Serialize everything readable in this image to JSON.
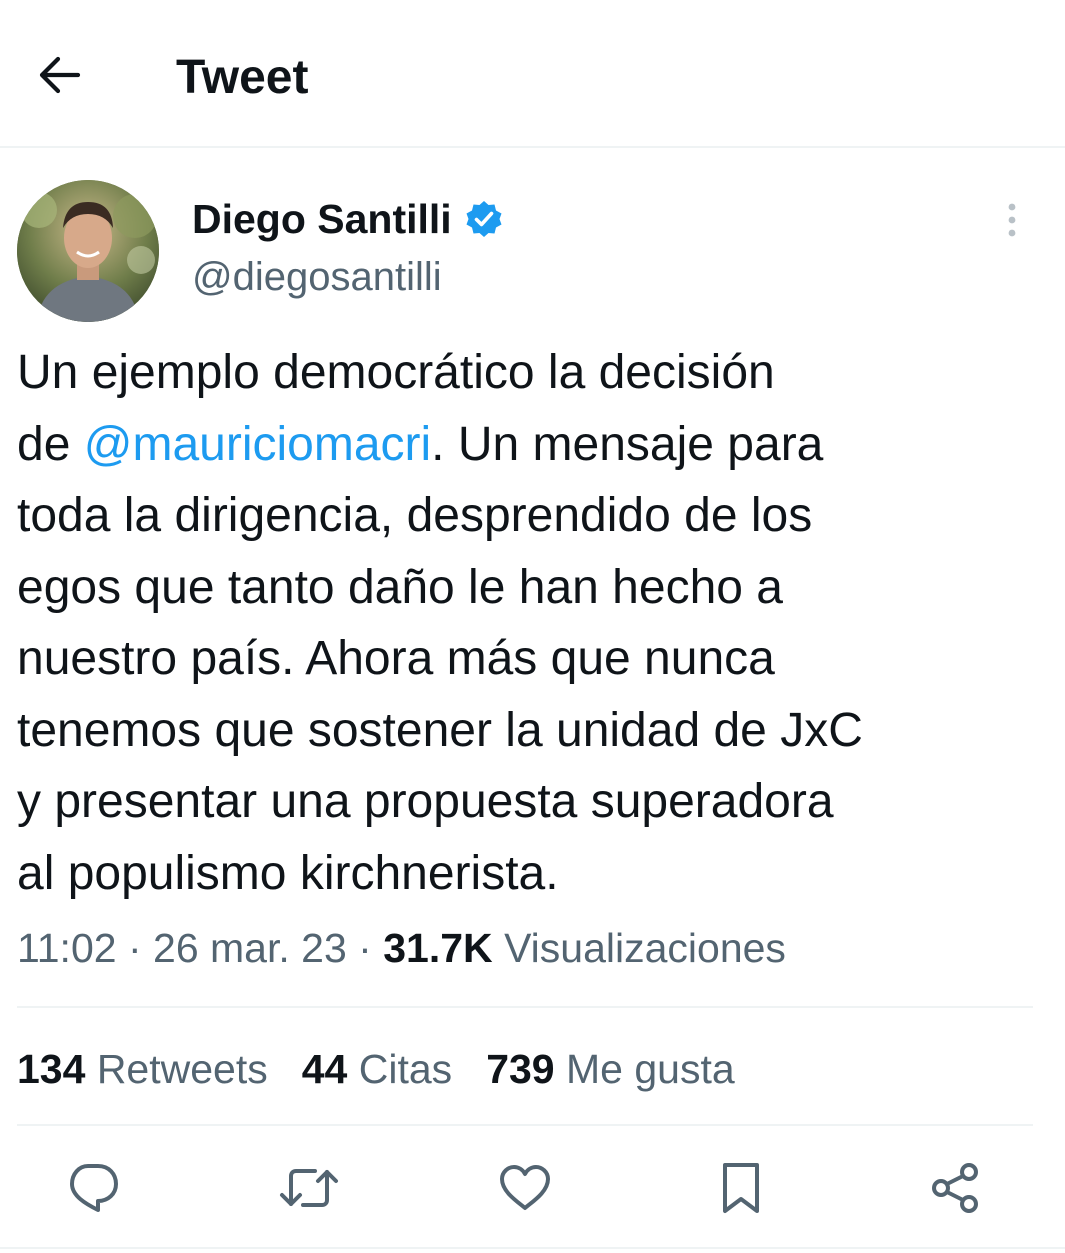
{
  "header": {
    "title": "Tweet",
    "back_icon": "arrow-left-icon"
  },
  "author": {
    "name": "Diego Santilli",
    "handle": "@diegosantilli",
    "verified_icon": "verified-badge-icon",
    "verified_color": "#1d9bf0"
  },
  "tweet": {
    "lines": [
      {
        "text": "Un ejemplo democrático la decisión"
      },
      {
        "before": "de ",
        "mention": "@mauriciomacri",
        "after": ". Un mensaje para"
      },
      {
        "text": "toda la dirigencia, desprendido de los"
      },
      {
        "text": "egos que tanto daño le han hecho a"
      },
      {
        "text": "nuestro país. Ahora más que nunca"
      },
      {
        "text": "tenemos que sostener la unidad de JxC"
      },
      {
        "text": "y presentar una propuesta superadora"
      },
      {
        "text": "al populismo kirchnerista."
      }
    ]
  },
  "meta": {
    "time": "11:02",
    "separator": "·",
    "date": "26 mar. 23",
    "views_count": "31.7K",
    "views_label": "Visualizaciones"
  },
  "stats": {
    "retweets_count": "134",
    "retweets_label": "Retweets",
    "quotes_count": "44",
    "quotes_label": "Citas",
    "likes_count": "739",
    "likes_label": "Me gusta"
  },
  "actions": [
    "reply-icon",
    "retweet-icon",
    "like-icon",
    "bookmark-icon",
    "share-icon"
  ],
  "colors": {
    "text_primary": "#0f1419",
    "text_secondary": "#536471",
    "accent": "#1d9bf0",
    "divider": "#eff3f4"
  }
}
